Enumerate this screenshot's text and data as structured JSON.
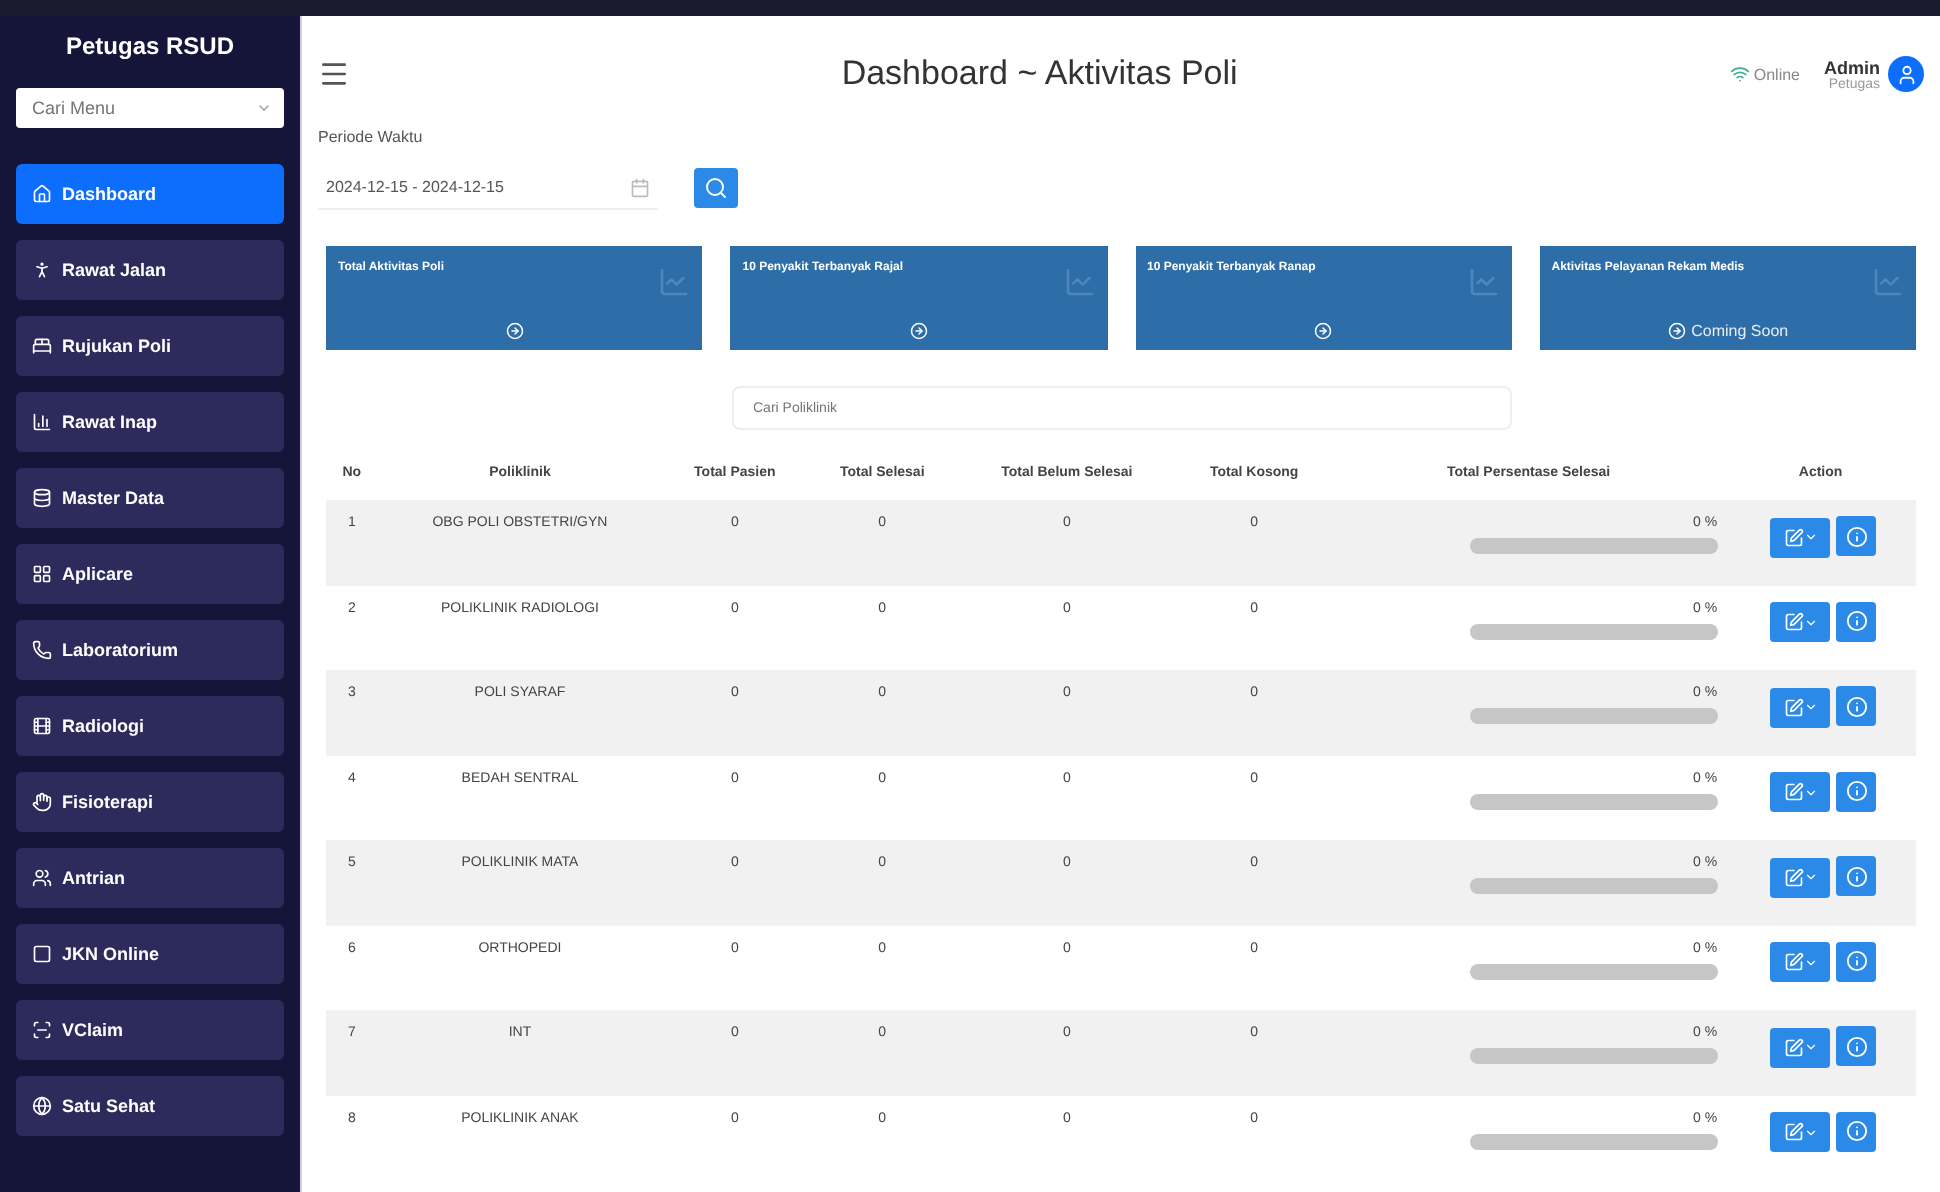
{
  "sidebar": {
    "title": "Petugas RSUD",
    "search": {
      "placeholder": "Cari Menu"
    },
    "items": [
      {
        "label": "Dashboard",
        "selected": true
      },
      {
        "label": "Rawat Jalan",
        "selected": false
      },
      {
        "label": "Rujukan Poli",
        "selected": false
      },
      {
        "label": "Rawat Inap",
        "selected": false
      },
      {
        "label": "Master Data",
        "selected": false
      },
      {
        "label": "Aplicare",
        "selected": false
      },
      {
        "label": "Laboratorium",
        "selected": false
      },
      {
        "label": "Radiologi",
        "selected": false
      },
      {
        "label": "Fisioterapi",
        "selected": false
      },
      {
        "label": "Antrian",
        "selected": false
      },
      {
        "label": "JKN Online",
        "selected": false
      },
      {
        "label": "VClaim",
        "selected": false
      },
      {
        "label": "Satu Sehat",
        "selected": false
      }
    ]
  },
  "header": {
    "title": "Dashboard ~ Aktivitas Poli",
    "status": "Online",
    "user": "Admin",
    "role": "Petugas"
  },
  "filter": {
    "label": "Periode Waktu",
    "value": "2024-12-15 - 2024-12-15"
  },
  "cards": [
    {
      "title": "Total Aktivitas Poli"
    },
    {
      "title": "10 Penyakit Terbanyak Rajal"
    },
    {
      "title": "10 Penyakit Terbanyak Ranap"
    },
    {
      "title": "Aktivitas Pelayanan Rekam Medis",
      "footer": "Coming Soon"
    }
  ],
  "table": {
    "search": {
      "placeholder": "Cari Poliklinik"
    },
    "columns": [
      "No",
      "Poliklinik",
      "Total Pasien",
      "Total Selesai",
      "Total Belum Selesai",
      "Total Kosong",
      "Total Persentase Selesai",
      "Action"
    ],
    "rows": [
      {
        "no": "1",
        "poli": "OBG POLI OBSTETRI/GYN",
        "pasien": "0",
        "selesai": "0",
        "belum": "0",
        "kosong": "0",
        "persen": "0 %",
        "level": 0
      },
      {
        "no": "2",
        "poli": "POLIKLINIK RADIOLOGI",
        "pasien": "0",
        "selesai": "0",
        "belum": "0",
        "kosong": "0",
        "persen": "0 %",
        "level": 0
      },
      {
        "no": "3",
        "poli": "POLI SYARAF",
        "pasien": "0",
        "selesai": "0",
        "belum": "0",
        "kosong": "0",
        "persen": "0 %",
        "level": 0
      },
      {
        "no": "4",
        "poli": "BEDAH SENTRAL",
        "pasien": "0",
        "selesai": "0",
        "belum": "0",
        "kosong": "0",
        "persen": "0 %",
        "level": 0
      },
      {
        "no": "5",
        "poli": "POLIKLINIK MATA",
        "pasien": "0",
        "selesai": "0",
        "belum": "0",
        "kosong": "0",
        "persen": "0 %",
        "level": 0
      },
      {
        "no": "6",
        "poli": "ORTHOPEDI",
        "pasien": "0",
        "selesai": "0",
        "belum": "0",
        "kosong": "0",
        "persen": "0 %",
        "level": 0
      },
      {
        "no": "7",
        "poli": "INT",
        "pasien": "0",
        "selesai": "0",
        "belum": "0",
        "kosong": "0",
        "persen": "0 %",
        "level": 0
      },
      {
        "no": "8",
        "poli": "POLIKLINIK ANAK",
        "pasien": "0",
        "selesai": "0",
        "belum": "0",
        "kosong": "0",
        "persen": "0 %",
        "level": 0
      }
    ]
  }
}
